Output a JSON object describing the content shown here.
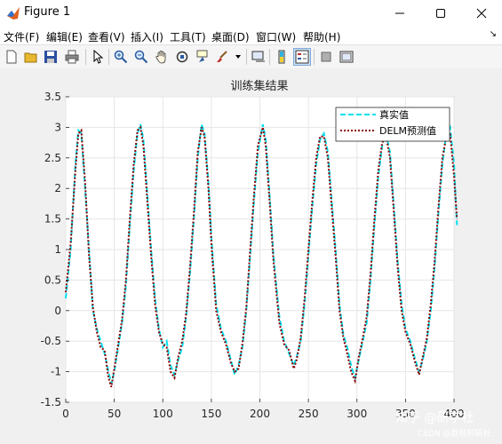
{
  "window": {
    "title": "Figure 1"
  },
  "menu": {
    "items": [
      "文件(F)",
      "编辑(E)",
      "查看(V)",
      "插入(I)",
      "工具(T)",
      "桌面(D)",
      "窗口(W)",
      "帮助(H)"
    ]
  },
  "toolbar": {
    "icons": [
      "new-figure-icon",
      "open-file-icon",
      "save-icon",
      "print-icon",
      "pointer-icon",
      "zoom-in-icon",
      "zoom-out-icon",
      "pan-icon",
      "rotate-3d-icon",
      "data-cursor-icon",
      "brush-icon",
      "link-plot-icon",
      "colorbar-icon",
      "legend-icon",
      "hide-plot-tools-icon",
      "show-plot-tools-icon"
    ]
  },
  "watermark": {
    "main": "知乎 @研学社",
    "sub": "CSDN @荔枝科研社"
  },
  "colors": {
    "series_true": "#00e0f0",
    "series_pred": "#8b0000",
    "axes_bg": "#ffffff",
    "grid": "#e6e6e6"
  },
  "chart_data": {
    "type": "line",
    "title": "训练集结果",
    "xlabel": "",
    "ylabel": "",
    "xlim": [
      0,
      400
    ],
    "ylim": [
      -1.5,
      3.5
    ],
    "xticks": [
      0,
      50,
      100,
      150,
      200,
      250,
      300,
      350,
      400
    ],
    "yticks": [
      -1.5,
      -1,
      -0.5,
      0,
      0.5,
      1,
      1.5,
      2,
      2.5,
      3,
      3.5
    ],
    "grid": true,
    "legend_position": "top-right",
    "series": [
      {
        "name": "真实值",
        "style": "dashed",
        "color": "#00e0f0",
        "points": [
          [
            0,
            0.2
          ],
          [
            5,
            1.0
          ],
          [
            10,
            2.4
          ],
          [
            13,
            2.95
          ],
          [
            16,
            2.9
          ],
          [
            20,
            2.0
          ],
          [
            24,
            1.0
          ],
          [
            28,
            0.0
          ],
          [
            32,
            -0.3
          ],
          [
            36,
            -0.5
          ],
          [
            40,
            -0.7
          ],
          [
            44,
            -1.0
          ],
          [
            47,
            -1.2
          ],
          [
            50,
            -1.0
          ],
          [
            54,
            -0.6
          ],
          [
            58,
            -0.2
          ],
          [
            62,
            0.4
          ],
          [
            66,
            1.4
          ],
          [
            70,
            2.3
          ],
          [
            74,
            2.9
          ],
          [
            77,
            3.05
          ],
          [
            80,
            2.8
          ],
          [
            84,
            1.9
          ],
          [
            88,
            1.0
          ],
          [
            92,
            0.2
          ],
          [
            96,
            -0.3
          ],
          [
            100,
            -0.6
          ],
          [
            104,
            -0.5
          ],
          [
            108,
            -0.9
          ],
          [
            112,
            -1.05
          ],
          [
            116,
            -0.8
          ],
          [
            120,
            -0.6
          ],
          [
            124,
            -0.1
          ],
          [
            128,
            0.6
          ],
          [
            132,
            1.5
          ],
          [
            136,
            2.5
          ],
          [
            140,
            3.05
          ],
          [
            143,
            2.9
          ],
          [
            147,
            2.1
          ],
          [
            150,
            1.2
          ],
          [
            155,
            0.1
          ],
          [
            160,
            -0.3
          ],
          [
            165,
            -0.5
          ],
          [
            170,
            -0.8
          ],
          [
            174,
            -1.05
          ],
          [
            178,
            -0.9
          ],
          [
            182,
            -0.6
          ],
          [
            186,
            0.0
          ],
          [
            190,
            0.9
          ],
          [
            194,
            1.8
          ],
          [
            198,
            2.6
          ],
          [
            203,
            3.05
          ],
          [
            206,
            2.8
          ],
          [
            210,
            1.9
          ],
          [
            214,
            0.9
          ],
          [
            220,
            -0.1
          ],
          [
            225,
            -0.5
          ],
          [
            230,
            -0.7
          ],
          [
            235,
            -0.9
          ],
          [
            238,
            -0.75
          ],
          [
            242,
            -0.5
          ],
          [
            246,
            0.1
          ],
          [
            250,
            0.9
          ],
          [
            254,
            1.7
          ],
          [
            258,
            2.4
          ],
          [
            262,
            2.8
          ],
          [
            266,
            2.9
          ],
          [
            270,
            2.6
          ],
          [
            274,
            1.8
          ],
          [
            278,
            1.0
          ],
          [
            282,
            0.1
          ],
          [
            286,
            -0.4
          ],
          [
            290,
            -0.6
          ],
          [
            294,
            -0.9
          ],
          [
            298,
            -1.1
          ],
          [
            302,
            -0.8
          ],
          [
            306,
            -0.5
          ],
          [
            310,
            -0.2
          ],
          [
            314,
            0.5
          ],
          [
            318,
            1.4
          ],
          [
            322,
            2.2
          ],
          [
            326,
            2.7
          ],
          [
            330,
            2.9
          ],
          [
            334,
            2.6
          ],
          [
            338,
            1.7
          ],
          [
            342,
            0.8
          ],
          [
            346,
            0.1
          ],
          [
            350,
            -0.3
          ],
          [
            355,
            -0.5
          ],
          [
            360,
            -0.8
          ],
          [
            364,
            -1.0
          ],
          [
            368,
            -0.8
          ],
          [
            372,
            -0.5
          ],
          [
            376,
            0.0
          ],
          [
            380,
            0.7
          ],
          [
            384,
            1.6
          ],
          [
            388,
            2.4
          ],
          [
            392,
            2.9
          ],
          [
            396,
            3.0
          ],
          [
            400,
            2.4
          ],
          [
            403,
            1.4
          ]
        ]
      },
      {
        "name": "DELM预测值",
        "style": "dotted",
        "color": "#8b0000",
        "points": [
          [
            0,
            0.3
          ],
          [
            5,
            1.1
          ],
          [
            10,
            2.3
          ],
          [
            13,
            2.9
          ],
          [
            16,
            2.95
          ],
          [
            20,
            2.1
          ],
          [
            24,
            0.9
          ],
          [
            28,
            0.05
          ],
          [
            32,
            -0.35
          ],
          [
            36,
            -0.6
          ],
          [
            40,
            -0.65
          ],
          [
            44,
            -1.1
          ],
          [
            47,
            -1.25
          ],
          [
            50,
            -0.95
          ],
          [
            54,
            -0.55
          ],
          [
            58,
            -0.15
          ],
          [
            62,
            0.5
          ],
          [
            66,
            1.5
          ],
          [
            70,
            2.4
          ],
          [
            74,
            2.95
          ],
          [
            77,
            3.0
          ],
          [
            80,
            2.7
          ],
          [
            84,
            1.8
          ],
          [
            88,
            0.9
          ],
          [
            92,
            0.1
          ],
          [
            96,
            -0.35
          ],
          [
            100,
            -0.55
          ],
          [
            104,
            -0.6
          ],
          [
            108,
            -1.0
          ],
          [
            112,
            -1.1
          ],
          [
            116,
            -0.75
          ],
          [
            120,
            -0.5
          ],
          [
            124,
            -0.05
          ],
          [
            128,
            0.7
          ],
          [
            132,
            1.6
          ],
          [
            136,
            2.6
          ],
          [
            140,
            3.0
          ],
          [
            143,
            2.85
          ],
          [
            147,
            2.0
          ],
          [
            150,
            1.1
          ],
          [
            155,
            0.0
          ],
          [
            160,
            -0.35
          ],
          [
            165,
            -0.55
          ],
          [
            170,
            -0.85
          ],
          [
            174,
            -1.0
          ],
          [
            178,
            -0.95
          ],
          [
            182,
            -0.55
          ],
          [
            186,
            0.05
          ],
          [
            190,
            1.0
          ],
          [
            194,
            1.9
          ],
          [
            198,
            2.7
          ],
          [
            203,
            3.0
          ],
          [
            206,
            2.7
          ],
          [
            210,
            1.8
          ],
          [
            214,
            0.8
          ],
          [
            220,
            -0.2
          ],
          [
            225,
            -0.55
          ],
          [
            230,
            -0.65
          ],
          [
            235,
            -0.95
          ],
          [
            238,
            -0.8
          ],
          [
            242,
            -0.45
          ],
          [
            246,
            0.2
          ],
          [
            250,
            1.0
          ],
          [
            254,
            1.8
          ],
          [
            258,
            2.5
          ],
          [
            262,
            2.85
          ],
          [
            266,
            2.85
          ],
          [
            270,
            2.5
          ],
          [
            274,
            1.7
          ],
          [
            278,
            0.9
          ],
          [
            282,
            0.0
          ],
          [
            286,
            -0.45
          ],
          [
            290,
            -0.7
          ],
          [
            294,
            -1.0
          ],
          [
            298,
            -1.15
          ],
          [
            302,
            -0.75
          ],
          [
            306,
            -0.45
          ],
          [
            310,
            -0.1
          ],
          [
            314,
            0.6
          ],
          [
            318,
            1.5
          ],
          [
            322,
            2.3
          ],
          [
            326,
            2.75
          ],
          [
            330,
            2.85
          ],
          [
            334,
            2.5
          ],
          [
            338,
            1.6
          ],
          [
            342,
            0.7
          ],
          [
            346,
            0.0
          ],
          [
            350,
            -0.35
          ],
          [
            355,
            -0.55
          ],
          [
            360,
            -0.85
          ],
          [
            364,
            -1.05
          ],
          [
            368,
            -0.75
          ],
          [
            372,
            -0.45
          ],
          [
            376,
            0.1
          ],
          [
            380,
            0.8
          ],
          [
            384,
            1.7
          ],
          [
            388,
            2.5
          ],
          [
            392,
            2.85
          ],
          [
            396,
            2.9
          ],
          [
            400,
            2.2
          ],
          [
            403,
            1.5
          ]
        ]
      }
    ]
  }
}
